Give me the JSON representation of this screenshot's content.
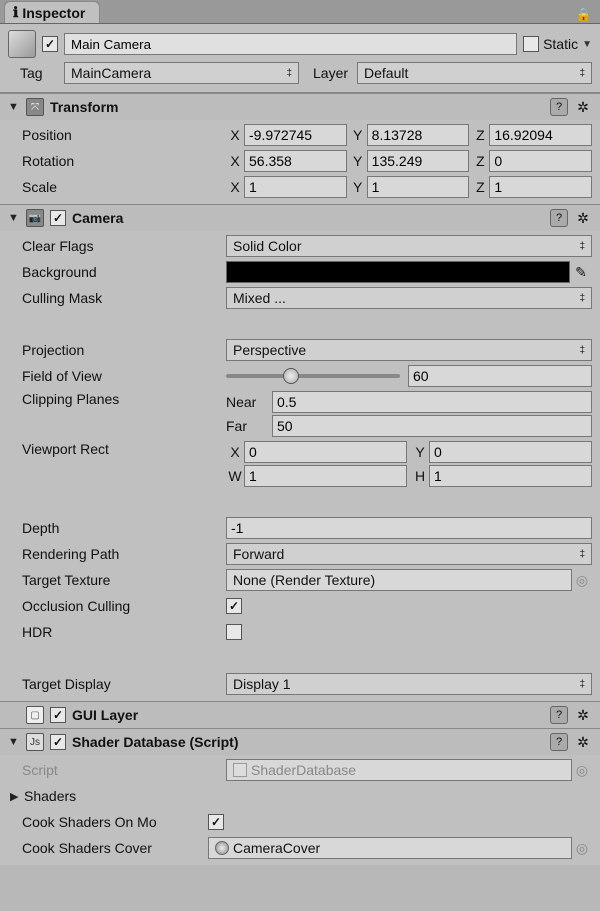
{
  "tab": {
    "title": "Inspector"
  },
  "header": {
    "name": "Main Camera",
    "static_label": "Static",
    "tag_label": "Tag",
    "tag_value": "MainCamera",
    "layer_label": "Layer",
    "layer_value": "Default"
  },
  "transform": {
    "title": "Transform",
    "position_label": "Position",
    "position": {
      "x": "-9.972745",
      "y": "8.13728",
      "z": "16.92094"
    },
    "rotation_label": "Rotation",
    "rotation": {
      "x": "56.358",
      "y": "135.249",
      "z": "0"
    },
    "scale_label": "Scale",
    "scale": {
      "x": "1",
      "y": "1",
      "z": "1"
    }
  },
  "camera": {
    "title": "Camera",
    "clear_flags_label": "Clear Flags",
    "clear_flags_value": "Solid Color",
    "background_label": "Background",
    "background_color": "#000000",
    "culling_mask_label": "Culling Mask",
    "culling_mask_value": "Mixed ...",
    "projection_label": "Projection",
    "projection_value": "Perspective",
    "fov_label": "Field of View",
    "fov_value": "60",
    "fov_percent": 33,
    "clipping_label": "Clipping Planes",
    "near_label": "Near",
    "near_value": "0.5",
    "far_label": "Far",
    "far_value": "50",
    "viewport_label": "Viewport Rect",
    "viewport": {
      "x": "0",
      "y": "0",
      "w": "1",
      "h": "1"
    },
    "depth_label": "Depth",
    "depth_value": "-1",
    "render_path_label": "Rendering Path",
    "render_path_value": "Forward",
    "target_texture_label": "Target Texture",
    "target_texture_value": "None (Render Texture)",
    "occlusion_label": "Occlusion Culling",
    "hdr_label": "HDR",
    "target_display_label": "Target Display",
    "target_display_value": "Display 1"
  },
  "gui_layer": {
    "title": "GUI Layer"
  },
  "shader_db": {
    "title": "Shader Database (Script)",
    "script_label": "Script",
    "script_value": "ShaderDatabase",
    "shaders_label": "Shaders",
    "cook_on_mo_label": "Cook Shaders On Mo",
    "cook_cover_label": "Cook Shaders Cover",
    "cook_cover_value": "CameraCover"
  },
  "axes": {
    "x": "X",
    "y": "Y",
    "z": "Z",
    "w": "W",
    "h": "H"
  }
}
